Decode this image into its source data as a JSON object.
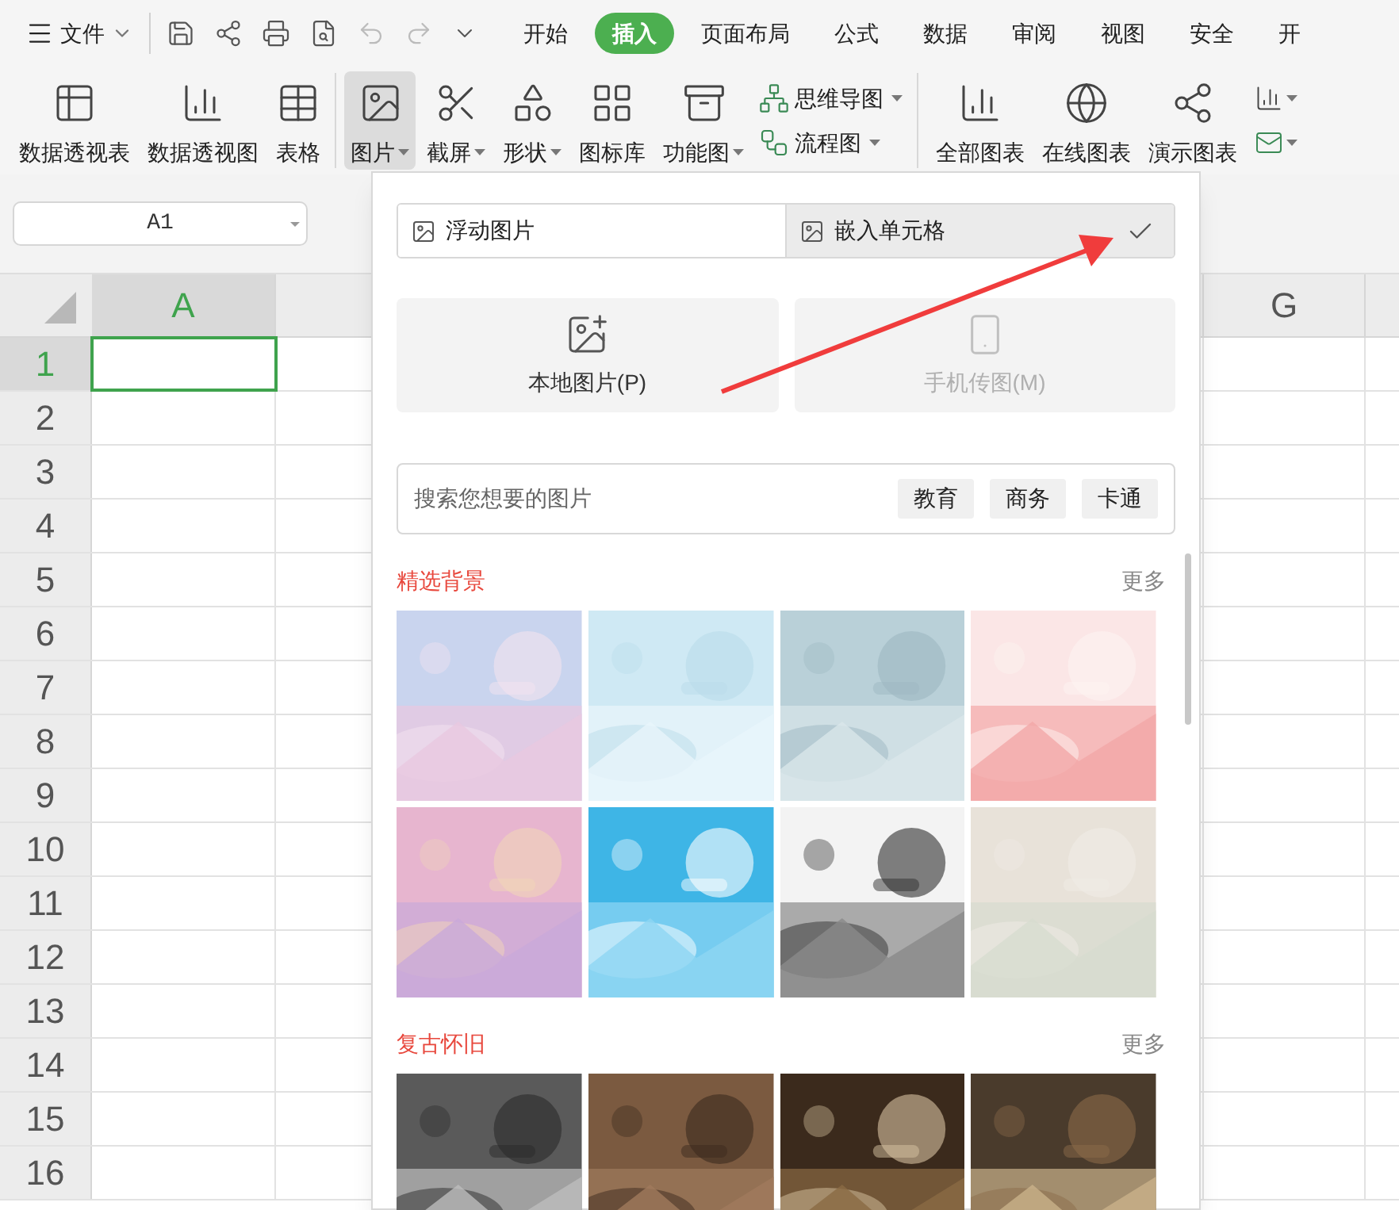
{
  "menu_bar": {
    "file_menu": "文件",
    "tabs": [
      {
        "label": "开始",
        "selected": false
      },
      {
        "label": "插入",
        "selected": true
      },
      {
        "label": "页面布局",
        "selected": false
      },
      {
        "label": "公式",
        "selected": false
      },
      {
        "label": "数据",
        "selected": false
      },
      {
        "label": "审阅",
        "selected": false
      },
      {
        "label": "视图",
        "selected": false
      },
      {
        "label": "安全",
        "selected": false
      },
      {
        "label": "开",
        "selected": false
      }
    ]
  },
  "ribbon": {
    "items": [
      {
        "kind": "large",
        "label": "数据透视表",
        "dropdown": false,
        "selected": false
      },
      {
        "kind": "large",
        "label": "数据透视图",
        "dropdown": false,
        "selected": false
      },
      {
        "kind": "large",
        "label": "表格",
        "dropdown": false,
        "selected": false
      },
      {
        "kind": "large",
        "label": "图片",
        "dropdown": true,
        "selected": true
      },
      {
        "kind": "large",
        "label": "截屏",
        "dropdown": true,
        "selected": false
      },
      {
        "kind": "large",
        "label": "形状",
        "dropdown": true,
        "selected": false
      },
      {
        "kind": "large",
        "label": "图标库",
        "dropdown": false,
        "selected": false
      },
      {
        "kind": "large",
        "label": "功能图",
        "dropdown": true,
        "selected": false
      },
      {
        "kind": "small",
        "label": "思维导图",
        "dropdown": true,
        "selected": false
      },
      {
        "kind": "small",
        "label": "流程图",
        "dropdown": true,
        "selected": false
      },
      {
        "kind": "large",
        "label": "全部图表",
        "dropdown": false,
        "selected": false
      },
      {
        "kind": "large",
        "label": "在线图表",
        "dropdown": false,
        "selected": false
      },
      {
        "kind": "large",
        "label": "演示图表",
        "dropdown": false,
        "selected": false
      }
    ]
  },
  "name_box": {
    "value": "A1"
  },
  "sheet": {
    "columns": [
      {
        "label": "A",
        "selected": true
      },
      {
        "label": "G",
        "selected": false
      }
    ],
    "rows": [
      {
        "label": "1",
        "selected": true
      },
      {
        "label": "2",
        "selected": false
      },
      {
        "label": "3",
        "selected": false
      },
      {
        "label": "4",
        "selected": false
      },
      {
        "label": "5",
        "selected": false
      },
      {
        "label": "6",
        "selected": false
      },
      {
        "label": "7",
        "selected": false
      },
      {
        "label": "8",
        "selected": false
      },
      {
        "label": "9",
        "selected": false
      },
      {
        "label": "10",
        "selected": false
      },
      {
        "label": "11",
        "selected": false
      },
      {
        "label": "12",
        "selected": false
      },
      {
        "label": "13",
        "selected": false
      },
      {
        "label": "14",
        "selected": false
      },
      {
        "label": "15",
        "selected": false
      },
      {
        "label": "16",
        "selected": false
      }
    ]
  },
  "picture_panel": {
    "insert_modes": [
      {
        "label": "浮动图片",
        "selected": false
      },
      {
        "label": "嵌入单元格",
        "selected": true
      }
    ],
    "sources": [
      {
        "label": "本地图片(P)",
        "disabled": false
      },
      {
        "label": "手机传图(M)",
        "disabled": true
      }
    ],
    "search": {
      "placeholder": "搜索您想要的图片",
      "tags": [
        "教育",
        "商务",
        "卡通"
      ]
    },
    "sections": [
      {
        "title": "精选背景",
        "more": "更多"
      },
      {
        "title": "复古怀旧",
        "more": "更多"
      }
    ]
  }
}
